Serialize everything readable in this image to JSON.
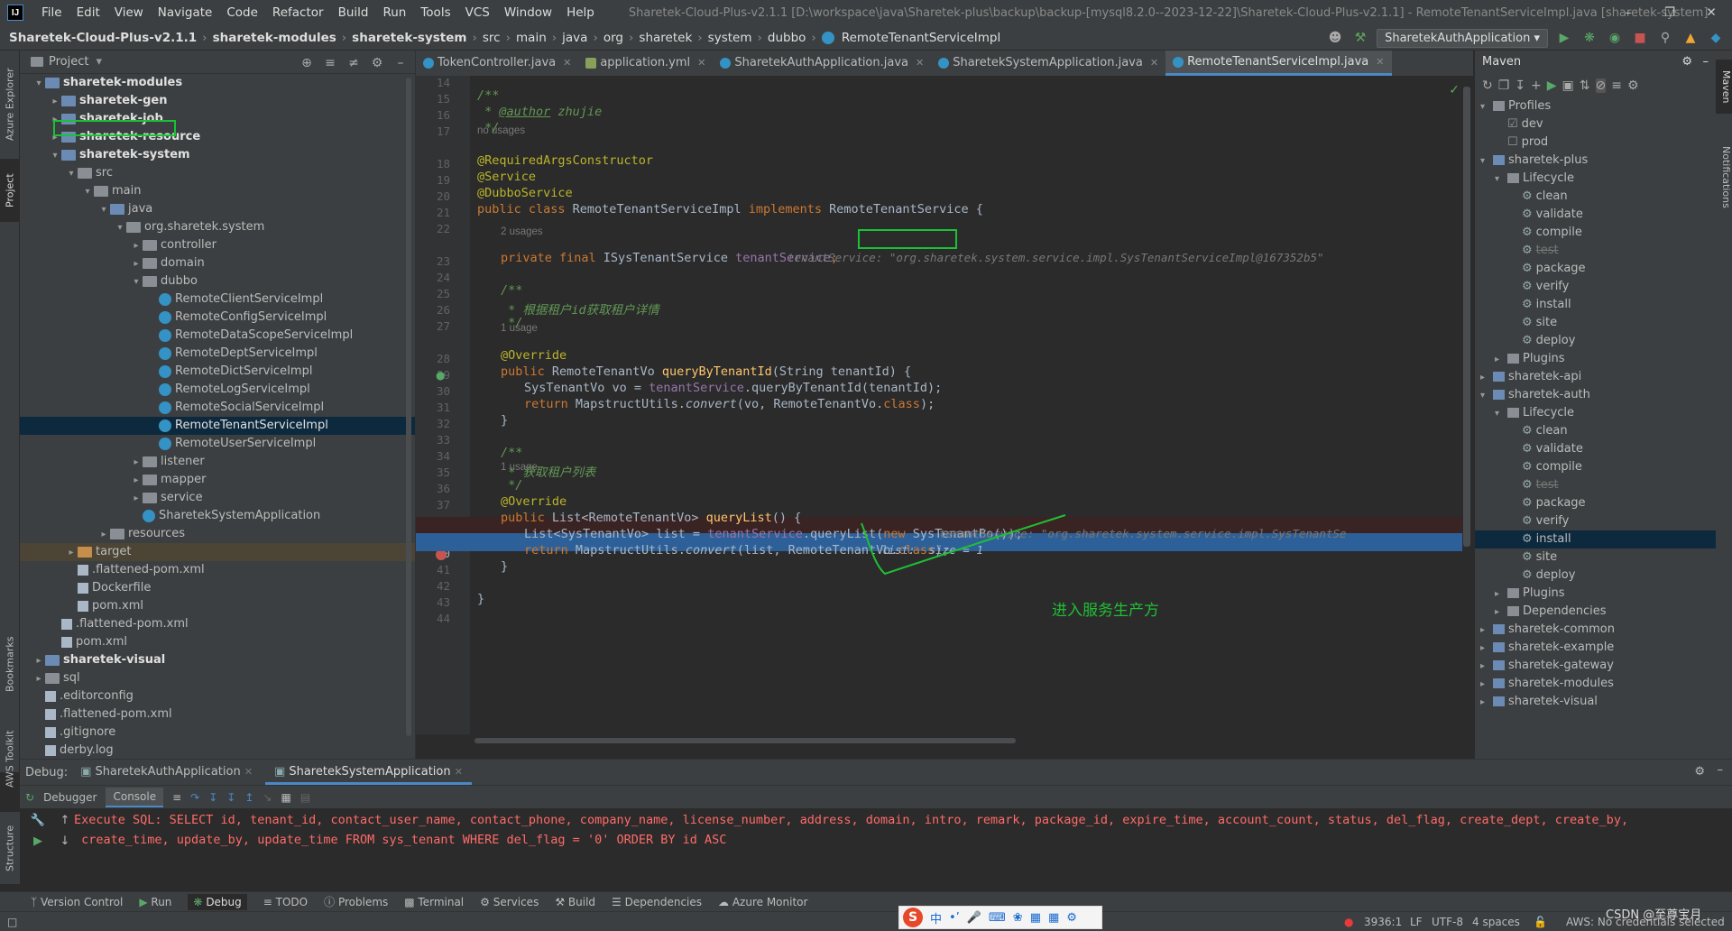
{
  "app": {
    "title": "Sharetek-Cloud-Plus-v2.1.1 [D:\\workspace\\java\\Sharetek-plus\\backup\\backup-[mysql8.2.0--2023-12-22]\\Sharetek-Cloud-Plus-v2.1.1] - RemoteTenantServiceImpl.java [sharetek-system]",
    "logo": "IJ"
  },
  "menu": [
    "File",
    "Edit",
    "View",
    "Navigate",
    "Code",
    "Refactor",
    "Build",
    "Run",
    "Tools",
    "VCS",
    "Window",
    "Help"
  ],
  "breadcrumbs": [
    "Sharetek-Cloud-Plus-v2.1.1",
    "sharetek-modules",
    "sharetek-system",
    "src",
    "main",
    "java",
    "org",
    "sharetek",
    "system",
    "dubbo",
    "RemoteTenantServiceImpl"
  ],
  "run_config": "SharetekAuthApplication",
  "left_strip": {
    "azure": "Azure Explorer",
    "project": "Project",
    "bookmarks": "Bookmarks",
    "aws": "AWS Toolkit",
    "structure": "Structure"
  },
  "right_strip": {
    "maven": "Maven",
    "notifications": "Notifications"
  },
  "project": {
    "title": "Project",
    "tree": [
      {
        "label": "sharetek-modules",
        "indent": 1,
        "arrow": "v",
        "icon": "mod",
        "bold": true
      },
      {
        "label": "sharetek-gen",
        "indent": 2,
        "arrow": ">",
        "icon": "mod",
        "bold": true
      },
      {
        "label": "sharetek-job",
        "indent": 2,
        "arrow": ">",
        "icon": "mod",
        "bold": true
      },
      {
        "label": "sharetek-resource",
        "indent": 2,
        "arrow": ">",
        "icon": "mod",
        "bold": true
      },
      {
        "label": "sharetek-system",
        "indent": 2,
        "arrow": "v",
        "icon": "mod",
        "bold": true
      },
      {
        "label": "src",
        "indent": 3,
        "arrow": "v",
        "icon": "fold"
      },
      {
        "label": "main",
        "indent": 4,
        "arrow": "v",
        "icon": "fold"
      },
      {
        "label": "java",
        "indent": 5,
        "arrow": "v",
        "icon": "src"
      },
      {
        "label": "org.sharetek.system",
        "indent": 6,
        "arrow": "v",
        "icon": "fold"
      },
      {
        "label": "controller",
        "indent": 7,
        "arrow": ">",
        "icon": "fold"
      },
      {
        "label": "domain",
        "indent": 7,
        "arrow": ">",
        "icon": "fold"
      },
      {
        "label": "dubbo",
        "indent": 7,
        "arrow": "v",
        "icon": "fold"
      },
      {
        "label": "RemoteClientServiceImpl",
        "indent": 8,
        "arrow": "",
        "icon": "cls"
      },
      {
        "label": "RemoteConfigServiceImpl",
        "indent": 8,
        "arrow": "",
        "icon": "cls"
      },
      {
        "label": "RemoteDataScopeServiceImpl",
        "indent": 8,
        "arrow": "",
        "icon": "cls"
      },
      {
        "label": "RemoteDeptServiceImpl",
        "indent": 8,
        "arrow": "",
        "icon": "cls"
      },
      {
        "label": "RemoteDictServiceImpl",
        "indent": 8,
        "arrow": "",
        "icon": "cls"
      },
      {
        "label": "RemoteLogServiceImpl",
        "indent": 8,
        "arrow": "",
        "icon": "cls"
      },
      {
        "label": "RemoteSocialServiceImpl",
        "indent": 8,
        "arrow": "",
        "icon": "cls"
      },
      {
        "label": "RemoteTenantServiceImpl",
        "indent": 8,
        "arrow": "",
        "icon": "cls",
        "selected": true
      },
      {
        "label": "RemoteUserServiceImpl",
        "indent": 8,
        "arrow": "",
        "icon": "cls"
      },
      {
        "label": "listener",
        "indent": 7,
        "arrow": ">",
        "icon": "fold"
      },
      {
        "label": "mapper",
        "indent": 7,
        "arrow": ">",
        "icon": "fold"
      },
      {
        "label": "service",
        "indent": 7,
        "arrow": ">",
        "icon": "fold"
      },
      {
        "label": "SharetekSystemApplication",
        "indent": 7,
        "arrow": "",
        "icon": "cls"
      },
      {
        "label": "resources",
        "indent": 5,
        "arrow": ">",
        "icon": "fold"
      },
      {
        "label": "target",
        "indent": 3,
        "arrow": ">",
        "icon": "tgt",
        "target": true
      },
      {
        "label": ".flattened-pom.xml",
        "indent": 3,
        "arrow": "",
        "icon": "file"
      },
      {
        "label": "Dockerfile",
        "indent": 3,
        "arrow": "",
        "icon": "file"
      },
      {
        "label": "pom.xml",
        "indent": 3,
        "arrow": "",
        "icon": "file",
        "prefix": "m"
      },
      {
        "label": ".flattened-pom.xml",
        "indent": 2,
        "arrow": "",
        "icon": "file"
      },
      {
        "label": "pom.xml",
        "indent": 2,
        "arrow": "",
        "icon": "file",
        "prefix": "m"
      },
      {
        "label": "sharetek-visual",
        "indent": 1,
        "arrow": ">",
        "icon": "mod",
        "bold": true
      },
      {
        "label": "sql",
        "indent": 1,
        "arrow": ">",
        "icon": "fold"
      },
      {
        "label": ".editorconfig",
        "indent": 1,
        "arrow": "",
        "icon": "file"
      },
      {
        "label": ".flattened-pom.xml",
        "indent": 1,
        "arrow": "",
        "icon": "file"
      },
      {
        "label": ".gitignore",
        "indent": 1,
        "arrow": "",
        "icon": "file"
      },
      {
        "label": "derby.log",
        "indent": 1,
        "arrow": "",
        "icon": "file"
      }
    ]
  },
  "tabs": [
    {
      "label": "TokenController.java",
      "icon": "cls"
    },
    {
      "label": "application.yml",
      "icon": "yml"
    },
    {
      "label": "SharetekAuthApplication.java",
      "icon": "cls"
    },
    {
      "label": "SharetekSystemApplication.java",
      "icon": "cls"
    },
    {
      "label": "RemoteTenantServiceImpl.java",
      "icon": "cls",
      "active": true
    }
  ],
  "code": {
    "line_numbers": [
      "14",
      "15",
      "16",
      "17",
      "18",
      "19",
      "20",
      "21",
      "22",
      "23",
      "24",
      "25",
      "26",
      "27",
      "28",
      "29",
      "30",
      "31",
      "32",
      "33",
      "34",
      "35",
      "36",
      "37",
      "38",
      "39",
      "40",
      "41",
      "42",
      "43",
      "44"
    ],
    "no_usages": "no usages",
    "usages_2": "2 usages",
    "usage_1": "1 usage",
    "usage_1b": "1 usage",
    "l15": "/**",
    "l16_a": " * ",
    "l16_tag": "@author",
    "l16_b": " zhujie",
    "l17": " */",
    "l18": "@RequiredArgsConstructor",
    "l19": "@Service",
    "l20": "@DubboService",
    "l21_kw": "public class ",
    "l21_name": "RemoteTenantServiceImpl ",
    "l21_kw2": "implements ",
    "l21_rest": "RemoteTenantService {",
    "l23_kw": "private final ",
    "l23_type": "ISysTenantService ",
    "l23_fld": "tenantService",
    ";": ";",
    "l23_hint": "tenantService: \"org.sharetek.system.service.impl.SysTenantServiceImpl@167352b5\"",
    "l25": "/**",
    "l26": " * 根据租户id获取租户详情",
    "l27": " */",
    "l28": "@Override",
    "l29_kw": "public ",
    "l29_type": "RemoteTenantVo ",
    "l29_fn": "queryByTenantId",
    "l29_rest": "(String tenantId) {",
    "l30_a": "SysTenantVo vo = ",
    "l30_fld": "tenantService",
    "l30_b": ".queryByTenantId(tenantId);",
    "l31_kw": "return ",
    "l31_a": "MapstructUtils.",
    "l31_fn": "convert",
    "l31_b": "(vo, RemoteTenantVo.",
    "l31_kw2": "class",
    ")": ");",
    "l32": "}",
    "l34": "/**",
    "l35": " * 获取租户列表",
    "l36": " */",
    "l37": "@Override",
    "l38_kw": "public ",
    "l38_type": "List<RemoteTenantVo> ",
    "l38_fn": "queryList",
    "l38_rest": "() {",
    "l39_a": "List<SysTenantVo> list = ",
    "l39_fld": "tenantService",
    "l39_b": ".queryList(",
    "l39_kw": "new ",
    "l39_c": "SysTenantBo());",
    "l39_hint": "tenantService: \"org.sharetek.system.service.impl.SysTenantSe",
    "l40_kw": "return ",
    "l40_a": "MapstructUtils.",
    "l40_fn": "convert",
    "l40_b": "(list, RemoteTenantVo.",
    "l40_kw2": "class",
    "l40_c": ");",
    "l40_hint": "list:  size = 1",
    "l41": "}",
    "l43": "}"
  },
  "annotation_note": "进入服务生产方",
  "maven": {
    "title": "Maven",
    "tree": [
      {
        "label": "Profiles",
        "indent": 0,
        "arrow": "v",
        "kind": "folder"
      },
      {
        "label": "dev",
        "indent": 1,
        "arrow": "",
        "kind": "check",
        "checked": true
      },
      {
        "label": "prod",
        "indent": 1,
        "arrow": "",
        "kind": "check",
        "checked": false
      },
      {
        "label": "sharetek-plus",
        "indent": 0,
        "arrow": "v",
        "kind": "mod"
      },
      {
        "label": "Lifecycle",
        "indent": 1,
        "arrow": "v",
        "kind": "folder"
      },
      {
        "label": "clean",
        "indent": 2,
        "arrow": "",
        "kind": "gear"
      },
      {
        "label": "validate",
        "indent": 2,
        "arrow": "",
        "kind": "gear"
      },
      {
        "label": "compile",
        "indent": 2,
        "arrow": "",
        "kind": "gear"
      },
      {
        "label": "test",
        "indent": 2,
        "arrow": "",
        "kind": "gear",
        "strike": true
      },
      {
        "label": "package",
        "indent": 2,
        "arrow": "",
        "kind": "gear"
      },
      {
        "label": "verify",
        "indent": 2,
        "arrow": "",
        "kind": "gear"
      },
      {
        "label": "install",
        "indent": 2,
        "arrow": "",
        "kind": "gear"
      },
      {
        "label": "site",
        "indent": 2,
        "arrow": "",
        "kind": "gear"
      },
      {
        "label": "deploy",
        "indent": 2,
        "arrow": "",
        "kind": "gear"
      },
      {
        "label": "Plugins",
        "indent": 1,
        "arrow": ">",
        "kind": "folder"
      },
      {
        "label": "sharetek-api",
        "indent": 0,
        "arrow": ">",
        "kind": "mod"
      },
      {
        "label": "sharetek-auth",
        "indent": 0,
        "arrow": "v",
        "kind": "mod"
      },
      {
        "label": "Lifecycle",
        "indent": 1,
        "arrow": "v",
        "kind": "folder"
      },
      {
        "label": "clean",
        "indent": 2,
        "arrow": "",
        "kind": "gear"
      },
      {
        "label": "validate",
        "indent": 2,
        "arrow": "",
        "kind": "gear"
      },
      {
        "label": "compile",
        "indent": 2,
        "arrow": "",
        "kind": "gear"
      },
      {
        "label": "test",
        "indent": 2,
        "arrow": "",
        "kind": "gear",
        "strike": true
      },
      {
        "label": "package",
        "indent": 2,
        "arrow": "",
        "kind": "gear"
      },
      {
        "label": "verify",
        "indent": 2,
        "arrow": "",
        "kind": "gear"
      },
      {
        "label": "install",
        "indent": 2,
        "arrow": "",
        "kind": "gear",
        "selected": true
      },
      {
        "label": "site",
        "indent": 2,
        "arrow": "",
        "kind": "gear"
      },
      {
        "label": "deploy",
        "indent": 2,
        "arrow": "",
        "kind": "gear"
      },
      {
        "label": "Plugins",
        "indent": 1,
        "arrow": ">",
        "kind": "folder"
      },
      {
        "label": "Dependencies",
        "indent": 1,
        "arrow": ">",
        "kind": "folder"
      },
      {
        "label": "sharetek-common",
        "indent": 0,
        "arrow": ">",
        "kind": "mod"
      },
      {
        "label": "sharetek-example",
        "indent": 0,
        "arrow": ">",
        "kind": "mod"
      },
      {
        "label": "sharetek-gateway",
        "indent": 0,
        "arrow": ">",
        "kind": "mod"
      },
      {
        "label": "sharetek-modules",
        "indent": 0,
        "arrow": ">",
        "kind": "mod"
      },
      {
        "label": "sharetek-visual",
        "indent": 0,
        "arrow": ">",
        "kind": "mod"
      }
    ]
  },
  "debug": {
    "label": "Debug:",
    "sessions": [
      "SharetekAuthApplication",
      "SharetekSystemApplication"
    ],
    "tabs": [
      "Debugger",
      "Console"
    ],
    "console_line1": "Execute SQL: SELECT id, tenant_id, contact_user_name, contact_phone, company_name, license_number, address, domain, intro, remark, package_id, expire_time, account_count, status, del_flag, create_dept, create_by,",
    "console_line2": " create_time, update_by, update_time FROM sys_tenant WHERE del_flag = '0' ORDER BY id ASC"
  },
  "bottom_tools": [
    "Version Control",
    "Run",
    "Debug",
    "TODO",
    "Problems",
    "Terminal",
    "Services",
    "Build",
    "Dependencies",
    "Azure Monitor"
  ],
  "status": {
    "position": "3936:1",
    "line_sep": "LF",
    "encoding": "UTF-8",
    "indent": "4 spaces",
    "aws": "AWS: No credentials selected",
    "watermark": "CSDN @至尊宝月"
  },
  "ime": {
    "logo": "S",
    "mode": "中"
  },
  "colors": {
    "accent": "#4a88c7",
    "green_box": "#19c235",
    "breakpoint": "#c75450",
    "exec_line": "#2d6099"
  }
}
